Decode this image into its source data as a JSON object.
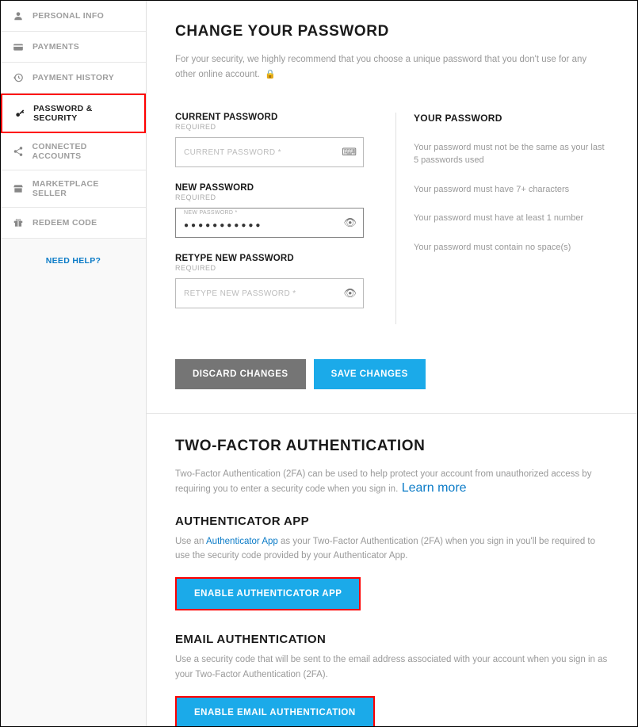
{
  "sidebar": {
    "items": [
      {
        "label": "PERSONAL INFO"
      },
      {
        "label": "PAYMENTS"
      },
      {
        "label": "PAYMENT HISTORY"
      },
      {
        "label": "PASSWORD & SECURITY"
      },
      {
        "label": "CONNECTED ACCOUNTS"
      },
      {
        "label": "MARKETPLACE SELLER"
      },
      {
        "label": "REDEEM CODE"
      }
    ],
    "help": "NEED HELP?"
  },
  "changePassword": {
    "title": "CHANGE YOUR PASSWORD",
    "desc": "For your security, we highly recommend that you choose a unique password that you don't use for any other online account.",
    "current": {
      "label": "CURRENT PASSWORD",
      "required": "REQUIRED",
      "placeholder": "CURRENT PASSWORD *"
    },
    "newp": {
      "label": "NEW PASSWORD",
      "required": "REQUIRED",
      "floating": "NEW PASSWORD *",
      "value": "●●●●●●●●●●●"
    },
    "retype": {
      "label": "RETYPE NEW PASSWORD",
      "required": "REQUIRED",
      "placeholder": "RETYPE NEW PASSWORD *"
    },
    "info": {
      "title": "YOUR PASSWORD",
      "rules": [
        "Your password must not be the same as your last 5 passwords used",
        "Your password must have 7+ characters",
        "Your password must have at least 1 number",
        "Your password must contain no space(s)"
      ]
    },
    "discard": "DISCARD CHANGES",
    "save": "SAVE CHANGES"
  },
  "twofa": {
    "title": "TWO-FACTOR AUTHENTICATION",
    "desc": "Two-Factor Authentication (2FA) can be used to help protect your account from unauthorized access by requiring you to enter a security code when you sign in.",
    "learn": "Learn more",
    "app": {
      "title": "AUTHENTICATOR APP",
      "prefix": "Use an ",
      "link": "Authenticator App",
      "suffix": " as your Two-Factor Authentication (2FA) when you sign in you'll be required to use the security code provided by your Authenticator App.",
      "button": "ENABLE AUTHENTICATOR APP"
    },
    "email": {
      "title": "EMAIL AUTHENTICATION",
      "desc": "Use a security code that will be sent to the email address associated with your account when you sign in as your Two-Factor Authentication (2FA).",
      "button": "ENABLE EMAIL AUTHENTICATION"
    }
  }
}
